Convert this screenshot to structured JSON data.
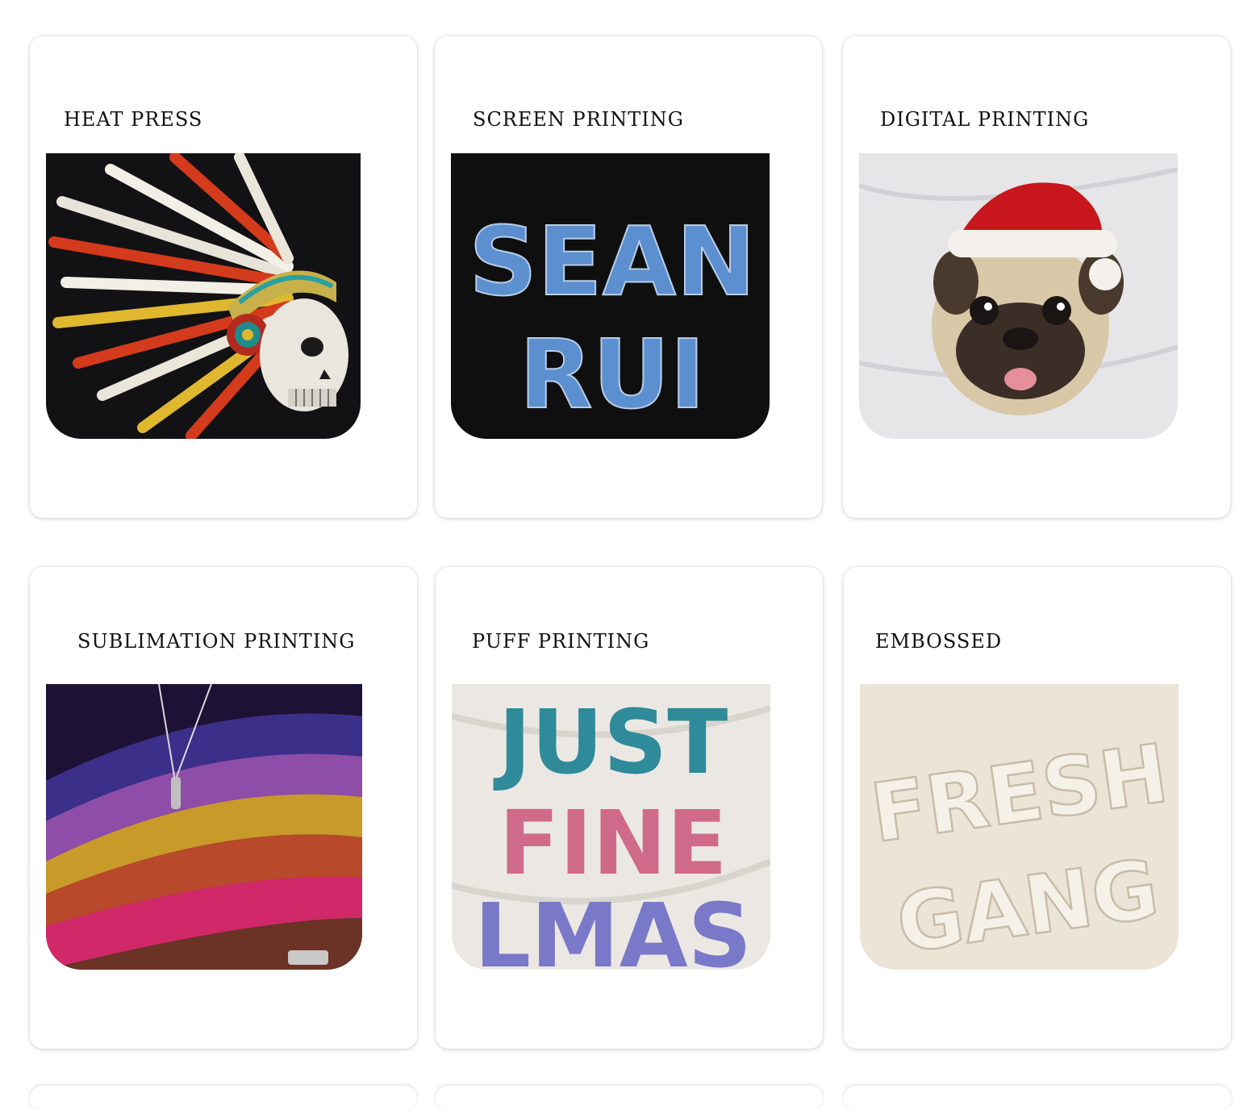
{
  "cards": [
    {
      "title": "HEAT PRESS",
      "image": "headdress-skull-tshirt-print"
    },
    {
      "title": "SCREEN PRINTING",
      "image": "sean-rui-denim-text-print",
      "image_text": [
        "SEAN",
        "RUI"
      ]
    },
    {
      "title": "DIGITAL PRINTING",
      "image": "santa-hat-pug-print"
    },
    {
      "title": "SUBLIMATION PRINTING",
      "image": "rainbow-swirl-allover-shirt"
    },
    {
      "title": "PUFF PRINTING",
      "image": "puff-letters-print",
      "image_text": [
        "JUST",
        "FINE",
        "LMAS"
      ]
    },
    {
      "title": "EMBOSSED",
      "image": "embossed-text-print",
      "image_text": [
        "FRESH",
        "GANG"
      ]
    }
  ],
  "colors": {
    "card_bg": "#ffffff",
    "title_text": "#111111",
    "page_bg": "#ffffff"
  }
}
